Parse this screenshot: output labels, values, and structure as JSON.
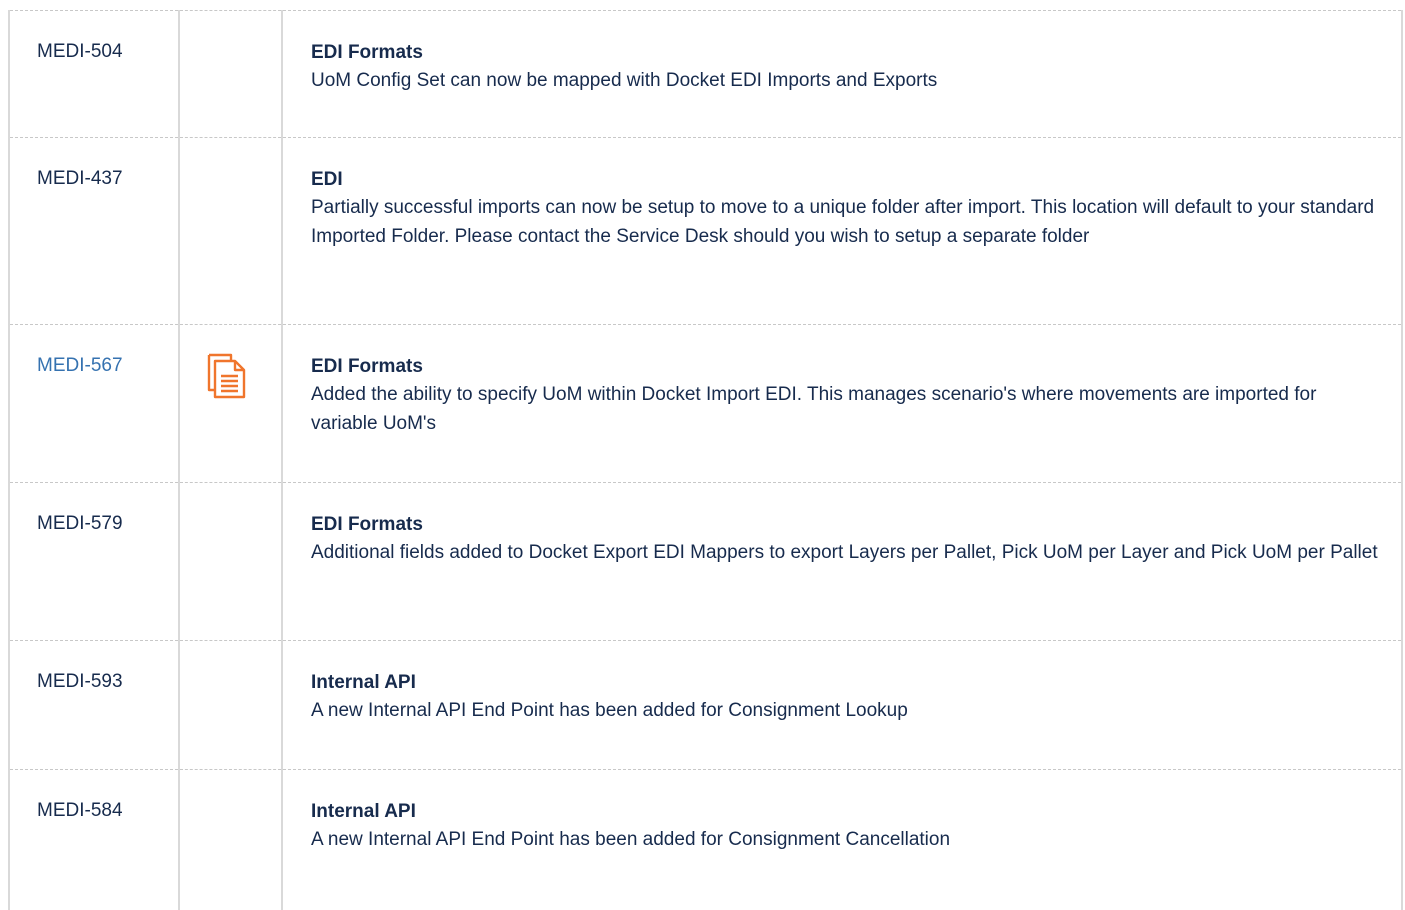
{
  "rows": [
    {
      "id": "MEDI-504",
      "is_link": false,
      "has_icon": false,
      "title": "EDI Formats",
      "text": "UoM Config Set can now be mapped with Docket EDI Imports and Exports"
    },
    {
      "id": "MEDI-437",
      "is_link": false,
      "has_icon": false,
      "title": "EDI",
      "text": "Partially successful imports can now be setup to move to a unique folder after import.  This location will default to your standard Imported Folder.  Please contact the Service Desk should you wish to setup a separate folder"
    },
    {
      "id": "MEDI-567",
      "is_link": true,
      "has_icon": true,
      "icon": "document-icon",
      "title": "EDI Formats",
      "text": "Added the ability to specify UoM within Docket Import EDI.  This manages scenario's where movements are imported for variable UoM's"
    },
    {
      "id": "MEDI-579",
      "is_link": false,
      "has_icon": false,
      "title": "EDI Formats",
      "text": "Additional fields added to Docket Export EDI Mappers to export Layers per Pallet,  Pick UoM per Layer and Pick UoM per Pallet"
    },
    {
      "id": "MEDI-593",
      "is_link": false,
      "has_icon": false,
      "title": "Internal API",
      "text": "A new Internal API End Point has been added for Consignment Lookup"
    },
    {
      "id": "MEDI-584",
      "is_link": false,
      "has_icon": false,
      "title": "Internal API",
      "text": "A new Internal API End Point has been added for Consignment Cancellation"
    }
  ],
  "colors": {
    "link": "#3572b0",
    "icon": "#f0752c",
    "text": "#172b4d",
    "border": "#d9d9d9"
  }
}
